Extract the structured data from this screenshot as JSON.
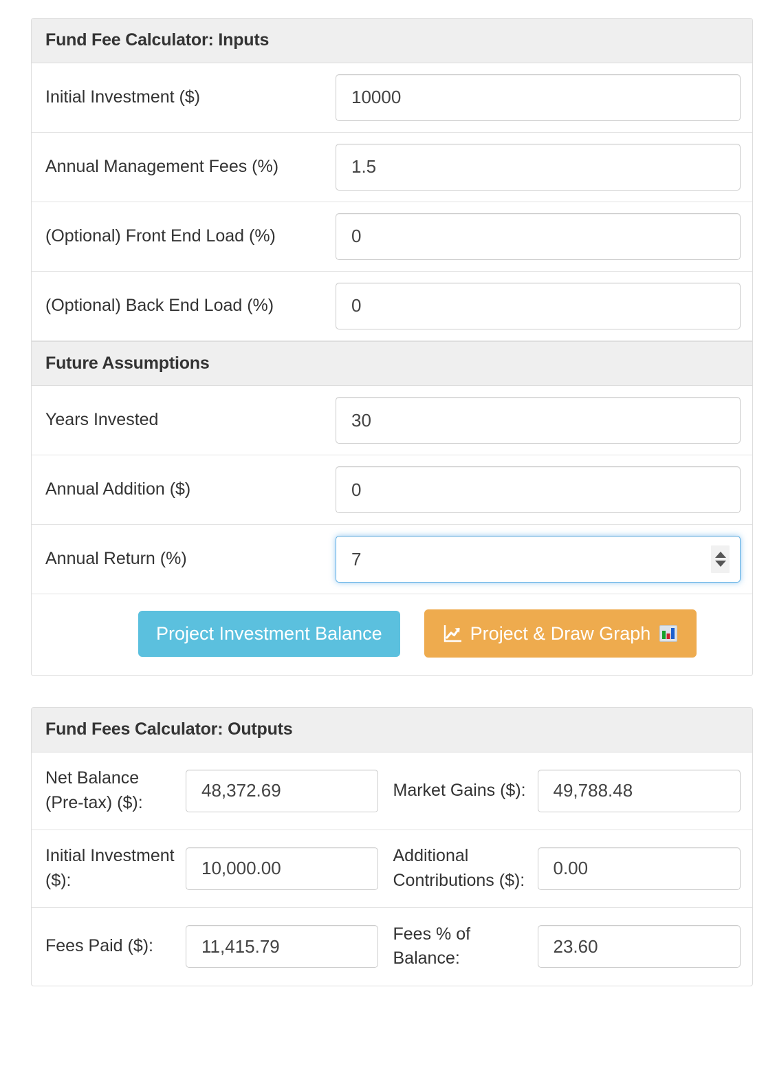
{
  "inputs_panel": {
    "title": "Fund Fee Calculator: Inputs",
    "fields": [
      {
        "label": "Initial Investment ($)",
        "value": "10000",
        "type": "text"
      },
      {
        "label": "Annual Management Fees (%)",
        "value": "1.5",
        "type": "text"
      },
      {
        "label": "(Optional) Front End Load (%)",
        "value": "0",
        "type": "text"
      },
      {
        "label": "(Optional) Back End Load (%)",
        "value": "0",
        "type": "text"
      }
    ]
  },
  "assumptions_panel": {
    "title": "Future Assumptions",
    "fields": [
      {
        "label": "Years Invested",
        "value": "30",
        "type": "text"
      },
      {
        "label": "Annual Addition ($)",
        "value": "0",
        "type": "text"
      },
      {
        "label": "Annual Return (%)",
        "value": "7",
        "type": "number",
        "focused": true
      }
    ]
  },
  "actions": {
    "project_label": "Project Investment Balance",
    "draw_graph_label": "Project & Draw Graph",
    "draw_graph_icon_left": "chart-increasing-icon",
    "draw_graph_icon_right": "bar-chart-icon",
    "project_button_color": "#5bc0de",
    "draw_graph_button_color": "#eeab4e"
  },
  "outputs_panel": {
    "title": "Fund Fees Calculator: Outputs",
    "rows": [
      [
        {
          "label": "Net Balance (Pre-tax) ($):",
          "value": "48,372.69"
        },
        {
          "label": "Market Gains ($):",
          "value": "49,788.48"
        }
      ],
      [
        {
          "label": "Initial Investment ($):",
          "value": "10,000.00"
        },
        {
          "label": "Additional Contributions ($):",
          "value": "0.00"
        }
      ],
      [
        {
          "label": "Fees Paid ($):",
          "value": "11,415.79"
        },
        {
          "label": "Fees % of Balance:",
          "value": "23.60"
        }
      ]
    ]
  }
}
